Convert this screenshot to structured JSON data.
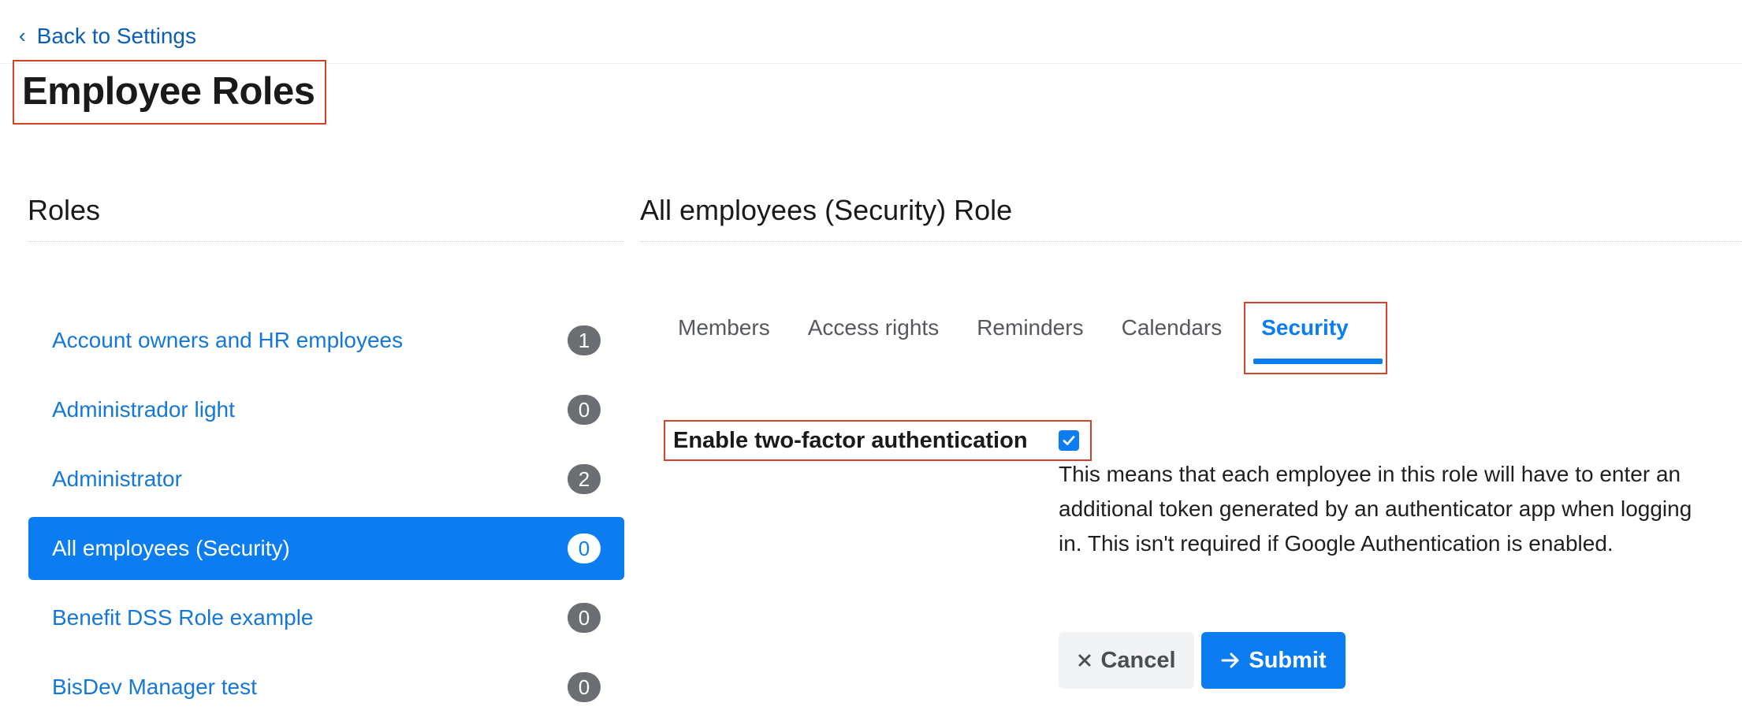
{
  "nav": {
    "back_label": "Back to Settings"
  },
  "page": {
    "title": "Employee Roles"
  },
  "roles_panel": {
    "heading": "Roles",
    "items": [
      {
        "label": "Account owners and HR employees",
        "count": "1",
        "active": false
      },
      {
        "label": "Administrador light",
        "count": "0",
        "active": false
      },
      {
        "label": "Administrator",
        "count": "2",
        "active": false
      },
      {
        "label": "All employees (Security)",
        "count": "0",
        "active": true
      },
      {
        "label": "Benefit DSS Role example",
        "count": "0",
        "active": false
      },
      {
        "label": "BisDev Manager test",
        "count": "0",
        "active": false
      }
    ]
  },
  "role_detail": {
    "heading": "All employees (Security) Role",
    "tabs": [
      {
        "label": "Members"
      },
      {
        "label": "Access rights"
      },
      {
        "label": "Reminders"
      },
      {
        "label": "Calendars"
      },
      {
        "label": "Security"
      }
    ],
    "active_tab": "Security",
    "two_factor": {
      "label": "Enable two-factor authentication",
      "checked": true,
      "help_text": "This means that each employee in this role will have to enter an additional token generated by an authenticator app when log­ging in. This isn't required if Google Authentication is enabled."
    },
    "actions": {
      "cancel_label": "Cancel",
      "submit_label": "Submit"
    }
  },
  "icons": {
    "back": "chevron-left-icon",
    "cancel": "close-icon",
    "submit": "arrow-right-icon",
    "check": "checkmark-icon"
  },
  "colors": {
    "accent": "#0b7df0",
    "link": "#1577d8",
    "highlight_border": "#d0452a",
    "badge": "#6b6e73"
  }
}
